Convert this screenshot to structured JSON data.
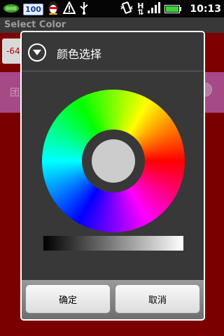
{
  "statusbar": {
    "notification_count": "100",
    "signal_label": "H",
    "time": "10:13",
    "icons": [
      "peas-app-icon",
      "notification-count-icon",
      "qq-penguin-icon",
      "warning-icon",
      "usb-icon",
      "vibrate-icon",
      "data-activity-icon",
      "signal-icon",
      "battery-icon"
    ]
  },
  "app": {
    "title": "Select Color",
    "field_value": "-64",
    "row_text": "团"
  },
  "dialog": {
    "title": "颜色选择",
    "ok_label": "确定",
    "cancel_label": "取消",
    "selected_color": "#cccccc"
  }
}
